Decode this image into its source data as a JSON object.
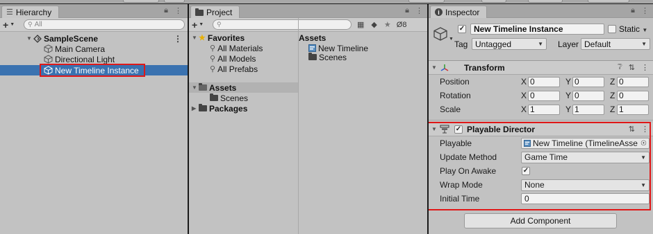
{
  "hierarchy": {
    "tab_label": "Hierarchy",
    "search_placeholder": "All",
    "scene": "SampleScene",
    "items": [
      "Main Camera",
      "Directional Light",
      "New Timeline Instance"
    ]
  },
  "project": {
    "tab_label": "Project",
    "hidden_count": "8",
    "favorites": {
      "label": "Favorites",
      "items": [
        "All Materials",
        "All Models",
        "All Prefabs"
      ]
    },
    "assets_tree": {
      "label": "Assets",
      "children": [
        "Scenes"
      ]
    },
    "packages_label": "Packages",
    "assets_pane": {
      "title": "Assets",
      "items": [
        "New Timeline",
        "Scenes"
      ]
    }
  },
  "inspector": {
    "tab_label": "Inspector",
    "object_name": "New Timeline Instance",
    "static_label": "Static",
    "tag_label": "Tag",
    "tag_value": "Untagged",
    "layer_label": "Layer",
    "layer_value": "Default",
    "transform": {
      "title": "Transform",
      "rows": [
        {
          "label": "Position",
          "x": "0",
          "y": "0",
          "z": "0"
        },
        {
          "label": "Rotation",
          "x": "0",
          "y": "0",
          "z": "0"
        },
        {
          "label": "Scale",
          "x": "1",
          "y": "1",
          "z": "1"
        }
      ]
    },
    "playable_director": {
      "title": "Playable Director",
      "playable_label": "Playable",
      "playable_value": "New Timeline (TimelineAsse",
      "update_method_label": "Update Method",
      "update_method_value": "Game Time",
      "play_on_awake_label": "Play On Awake",
      "wrap_mode_label": "Wrap Mode",
      "wrap_mode_value": "None",
      "initial_time_label": "Initial Time",
      "initial_time_value": "0"
    },
    "add_component_label": "Add Component"
  },
  "colors": {
    "selection": "#3a72b0",
    "highlight_box": "#e01818",
    "panel_bg": "#c2c2c2",
    "tab_bar": "#a5a5a5"
  }
}
